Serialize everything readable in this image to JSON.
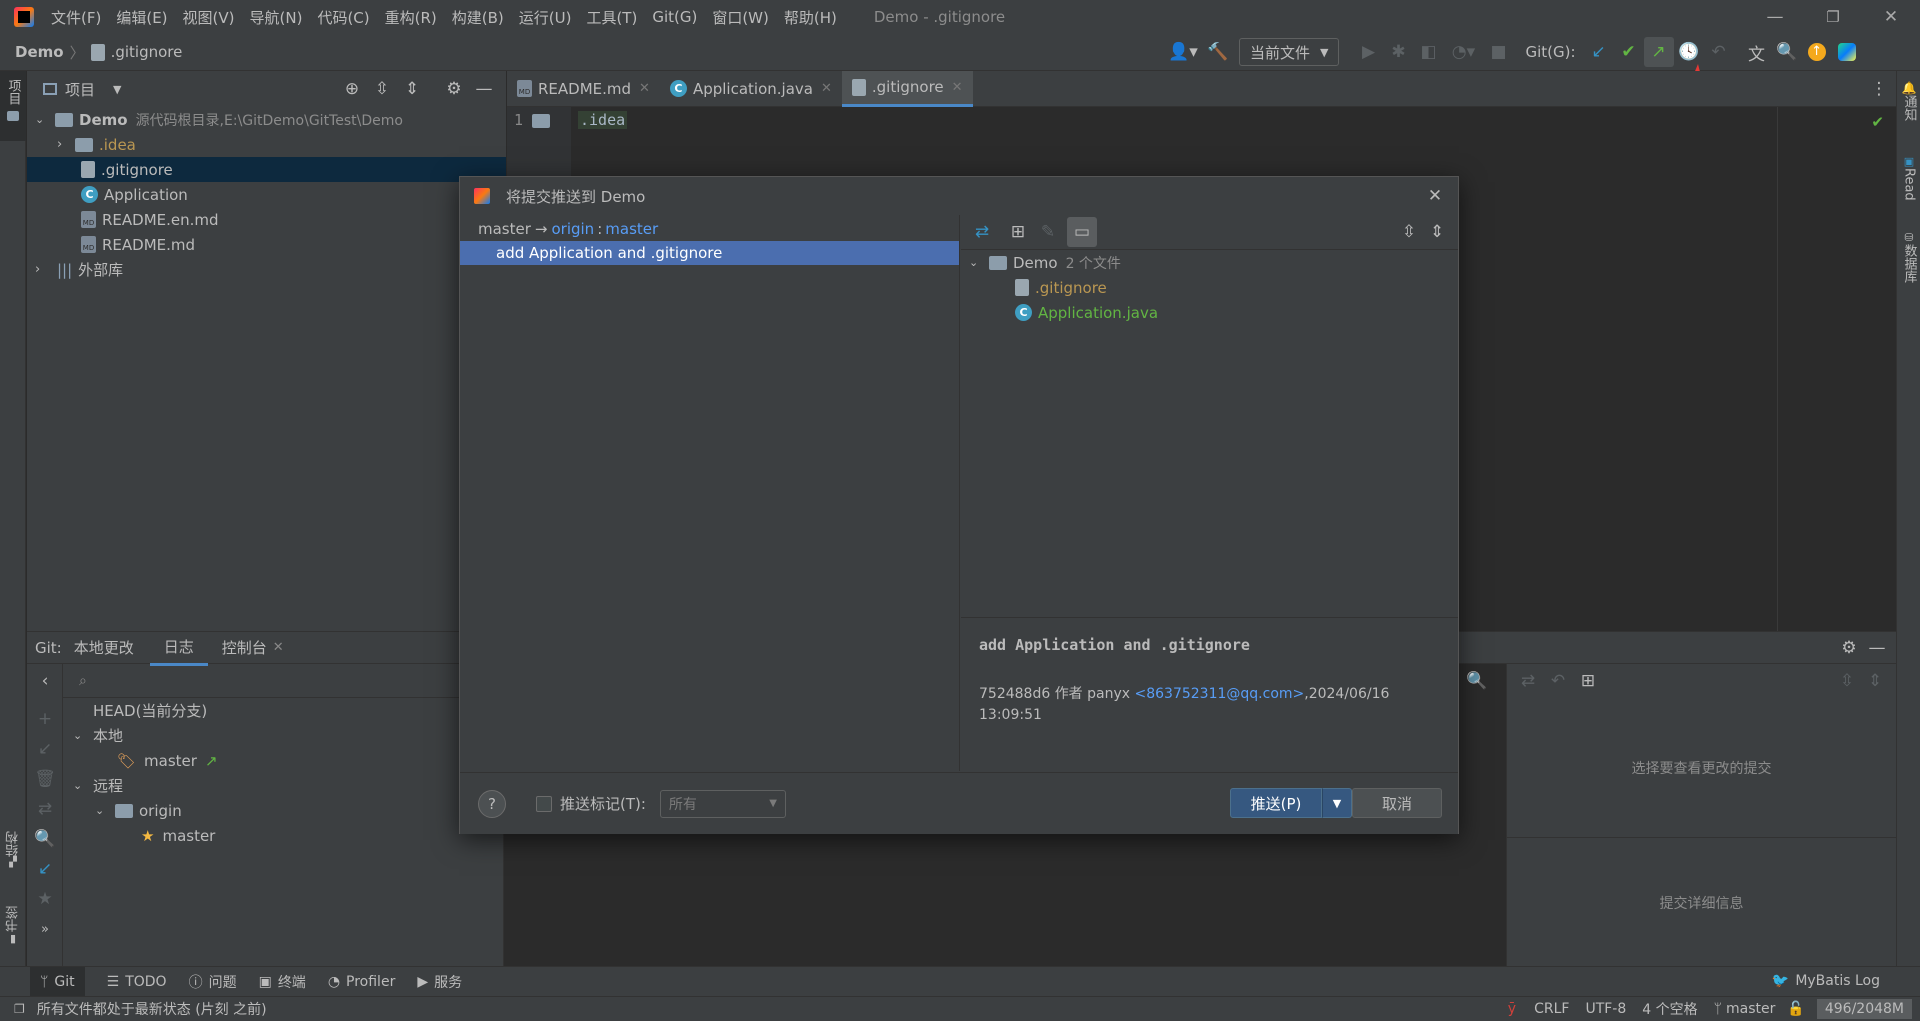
{
  "titlebar": {
    "menus": [
      "文件(F)",
      "编辑(E)",
      "视图(V)",
      "导航(N)",
      "代码(C)",
      "重构(R)",
      "构建(B)",
      "运行(U)",
      "工具(T)",
      "Git(G)",
      "窗口(W)",
      "帮助(H)"
    ],
    "window_title": "Demo - .gitignore"
  },
  "navbar": {
    "breadcrumb_project": "Demo",
    "breadcrumb_file": ".gitignore",
    "run_config": "当前文件",
    "git_label": "Git(G):"
  },
  "project_panel": {
    "title": "项目",
    "root_name": "Demo",
    "root_desc": "源代码根目录,E:\\GitDemo\\GitTest\\Demo",
    "items": [
      ".idea",
      ".gitignore",
      "Application",
      "README.en.md",
      "README.md"
    ],
    "external_libs": "外部库"
  },
  "editor": {
    "tabs": [
      "README.md",
      "Application.java",
      ".gitignore"
    ],
    "line_number": "1",
    "line_text": ".idea"
  },
  "left_stripe": {
    "project": "项目",
    "structure": "结构",
    "bookmarks": "书签"
  },
  "right_stripe": {
    "notifications": "通知",
    "read": "Read",
    "database": "数据库"
  },
  "git_panel": {
    "prefix": "Git:",
    "tabs": [
      "本地更改",
      "日志",
      "控制台"
    ],
    "head": "HEAD(当前分支)",
    "local": "本地",
    "local_master": "master",
    "remote": "远程",
    "origin": "origin",
    "remote_master": "master",
    "select_commit_hint": "选择要查看更改的提交",
    "commit_details": "提交详细信息"
  },
  "dialog": {
    "title": "将提交推送到 Demo",
    "branch_from": "master",
    "arrow": "→",
    "remote": "origin",
    "colon": ":",
    "branch_to": "master",
    "commit": "add Application and .gitignore",
    "tree_root": "Demo",
    "tree_count": "2 个文件",
    "files": [
      ".gitignore",
      "Application.java"
    ],
    "detail_message": "add Application and .gitignore",
    "detail_hash": "752488d6 作者 panyx",
    "detail_email": "<863752311@qq.com>",
    "detail_date": ",2024/06/16 13:09:51",
    "help": "?",
    "push_tags_label": "推送标记(T):",
    "push_tags_value": "所有",
    "push_button": "推送(P)",
    "cancel_button": "取消"
  },
  "bottom_toolbar": {
    "items": [
      "Git",
      "TODO",
      "问题",
      "终端",
      "Profiler",
      "服务"
    ],
    "mybatis": "MyBatis Log"
  },
  "statusbar": {
    "message": "所有文件都处于最新状态 (片刻 之前)",
    "line_sep": "CRLF",
    "encoding": "UTF-8",
    "indent": "4 个空格",
    "branch": "master",
    "memory": "496/2048M"
  },
  "colors": {
    "selection": "#4b6eaf",
    "tree_selection": "#0d293e",
    "accent": "#589df6",
    "added": "#62b543",
    "ignored": "#ba9752"
  }
}
